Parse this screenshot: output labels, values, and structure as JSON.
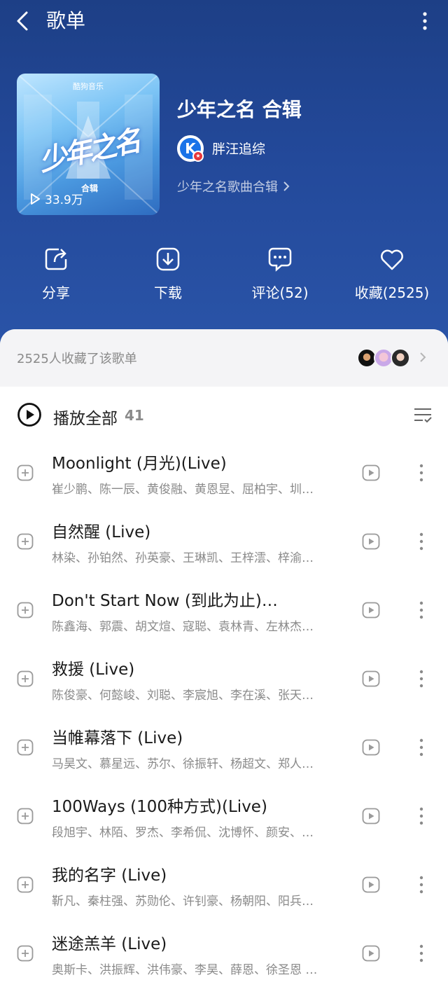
{
  "nav": {
    "title": "歌单"
  },
  "cover": {
    "brand": "酷狗音乐",
    "calligraphy": "少年之名",
    "sub": "合辑",
    "play_count": "33.9万"
  },
  "playlist": {
    "title": "少年之名 合辑",
    "creator": "胖汪追综",
    "description": "少年之名歌曲合辑"
  },
  "actions": [
    {
      "label": "分享",
      "icon": "share-icon"
    },
    {
      "label": "下载",
      "icon": "download-icon"
    },
    {
      "label": "评论(52)",
      "icon": "comment-icon"
    },
    {
      "label": "收藏(2525)",
      "icon": "heart-icon"
    }
  ],
  "collect": {
    "text": "2525人收藏了该歌单"
  },
  "play_all": {
    "label": "播放全部",
    "count": "41"
  },
  "songs": [
    {
      "title": "Moonlight (月光)(Live)",
      "artists": "崔少鹏、陈一辰、黄俊融、黄恩昱、屈柏宇、圳…"
    },
    {
      "title": "自然醒 (Live)",
      "artists": "林染、孙铂然、孙英豪、王琳凯、王梓澐、梓渝…"
    },
    {
      "title": "Don't Start Now (到此为止)…",
      "artists": "陈鑫海、郭震、胡文煊、寇聪、袁林青、左林杰…"
    },
    {
      "title": "救援 (Live)",
      "artists": "陈俊豪、何懿峻、刘聪、李宸旭、李在溪、张天…"
    },
    {
      "title": "当帷幕落下 (Live)",
      "artists": "马昊文、慕星远、苏尔、徐振轩、杨超文、郑人…"
    },
    {
      "title": "100Ways (100种方式)(Live)",
      "artists": "段旭宇、林陌、罗杰、李希侃、沈博怀、颜安、…"
    },
    {
      "title": "我的名字 (Live)",
      "artists": "靳凡、秦柱强、苏勋伦、许钊豪、杨朝阳、阳兵…"
    },
    {
      "title": "迷途羔羊 (Live)",
      "artists": "奥斯卡、洪振辉、洪伟豪、李昊、薛恩、徐圣恩 …"
    }
  ]
}
